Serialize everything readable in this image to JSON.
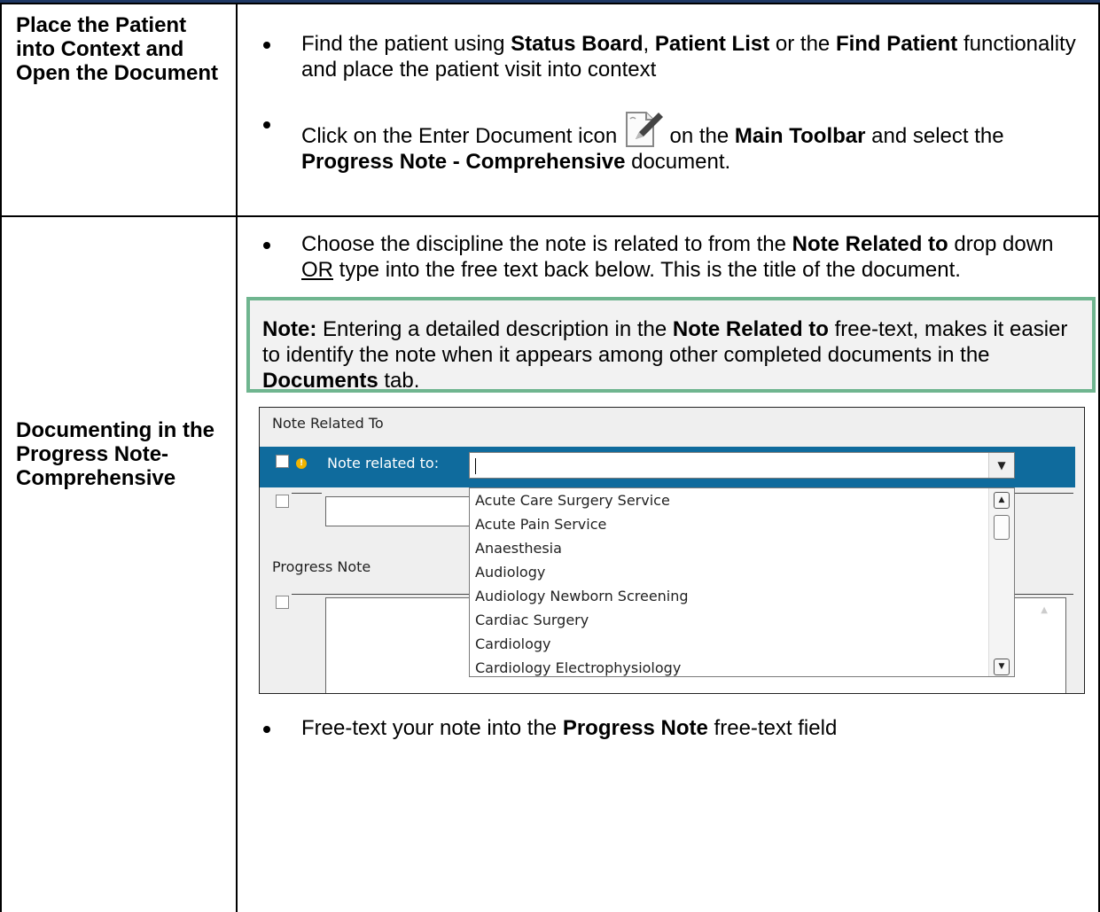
{
  "rows": [
    {
      "label": "Place the Patient into Context and Open the Document",
      "bullet1": {
        "t1": "Find the patient using ",
        "b1": "Status Board",
        "t2": ", ",
        "b2": "Patient List",
        "t3": " or the ",
        "b3": "Find Patient",
        "t4": " functionality and place the patient visit into context"
      },
      "bullet2": {
        "t1": "Click on the Enter Document icon ",
        "icon": "enter-document-icon",
        "t2": " on the ",
        "b1": "Main Toolbar",
        "t3": " and select the ",
        "b2": "Progress Note - Comprehensive",
        "t4": " document."
      }
    },
    {
      "label": "Documenting in the Progress Note- Comprehensive",
      "bullet1": {
        "t1": "Choose the discipline the note is related to from the ",
        "b1": "Note Related to",
        "t2": " drop down ",
        "u1": "OR",
        "t3": " type into the free text back below. This is the title of the document."
      },
      "note": {
        "b0": "Note:",
        "t1": " Entering a detailed description in the ",
        "b1": "Note Related to",
        "t2": " free-text, makes it easier to identify the note when it appears among other completed documents in the ",
        "b2": "Documents",
        "t3": " tab."
      },
      "bullet2": {
        "t1": "Free-text your note into the ",
        "b1": "Progress Note",
        "t2": " free-text field"
      }
    }
  ],
  "screenshot": {
    "section1_title": "Note Related To",
    "field_label": "Note related to:",
    "combo_value": "",
    "section2_title": "Progress Note",
    "options": [
      "Acute Care Surgery Service",
      "Acute Pain Service",
      "Anaesthesia",
      "Audiology",
      "Audiology Newborn Screening",
      "Cardiac Surgery",
      "Cardiology",
      "Cardiology Electrophysiology"
    ],
    "colors": {
      "row_highlight": "#0f6b9d",
      "note_border": "#6fb58f"
    }
  }
}
